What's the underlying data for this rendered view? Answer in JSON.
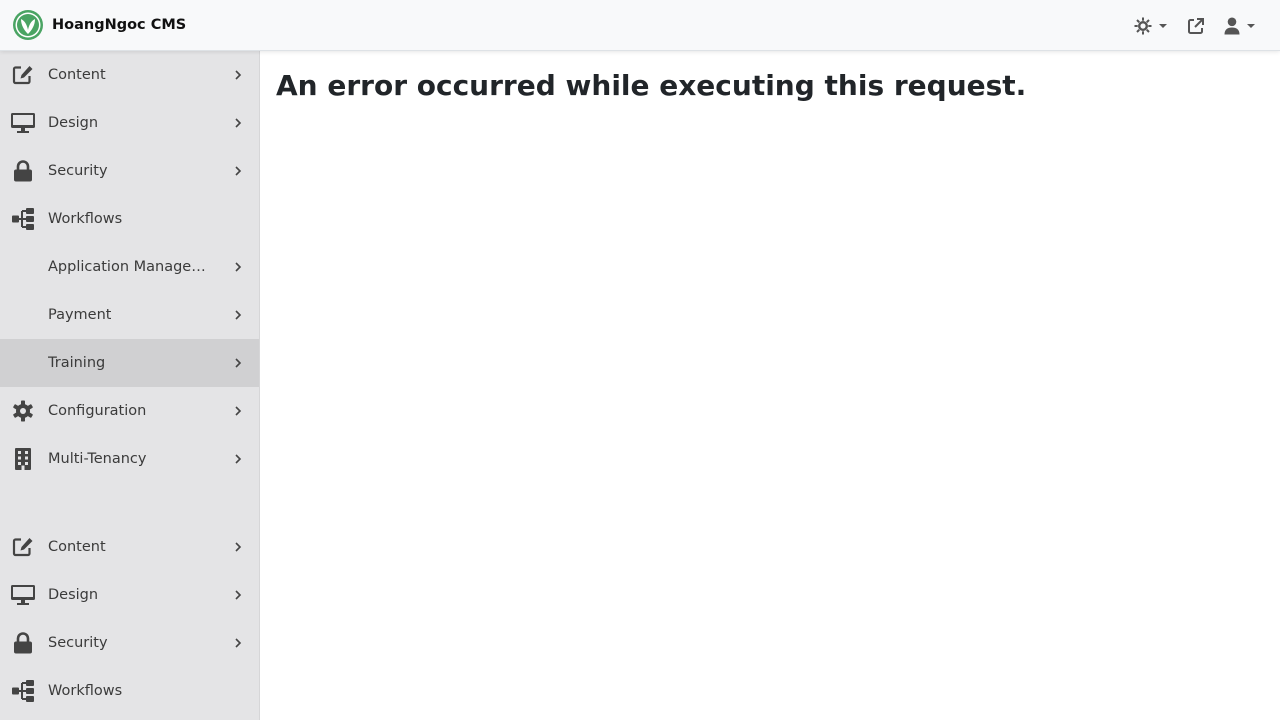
{
  "app": {
    "title": "HoangNgoc CMS"
  },
  "header": {
    "theme_icon": "sun-gear-icon",
    "preview_icon": "external-link-icon",
    "user_icon": "user-icon"
  },
  "sidebar": {
    "items": [
      {
        "label": "Content",
        "icon": "edit-icon"
      },
      {
        "label": "Design",
        "icon": "monitor-icon"
      },
      {
        "label": "Security",
        "icon": "lock-icon"
      },
      {
        "label": "Workflows",
        "icon": "sitemap-icon"
      },
      {
        "label": "Application Management"
      },
      {
        "label": "Payment"
      },
      {
        "label": "Training"
      },
      {
        "label": "Configuration",
        "icon": "gear-icon"
      },
      {
        "label": "Multi-Tenancy",
        "icon": "building-icon"
      }
    ],
    "items_repeat": [
      {
        "label": "Content",
        "icon": "edit-icon"
      },
      {
        "label": "Design",
        "icon": "monitor-icon"
      },
      {
        "label": "Security",
        "icon": "lock-icon"
      },
      {
        "label": "Workflows",
        "icon": "sitemap-icon"
      }
    ]
  },
  "main": {
    "error_message": "An error occurred while executing this request."
  },
  "colors": {
    "brand_green": "#5cb85c",
    "sidebar_bg": "#e4e4e6",
    "sidebar_active": "#d0d0d2"
  }
}
